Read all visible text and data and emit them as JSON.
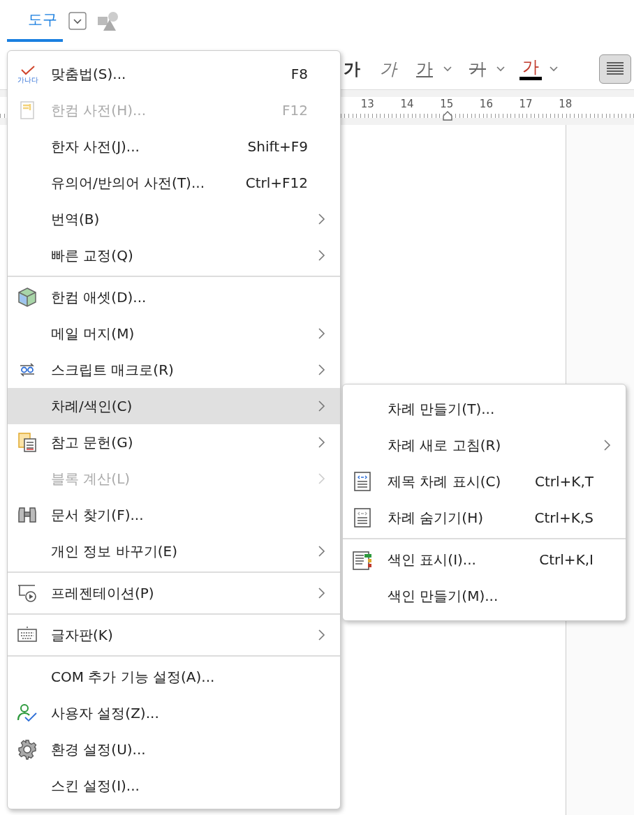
{
  "tabs": [
    {
      "label": "도구",
      "selected": true,
      "dropdown": true
    }
  ],
  "format_buttons": [
    {
      "kind": "bold",
      "label": "가",
      "dropdown": false
    },
    {
      "kind": "italic",
      "label": "가",
      "dropdown": false
    },
    {
      "kind": "underline",
      "label": "가",
      "dropdown": true
    },
    {
      "kind": "strike",
      "label": "가",
      "dropdown": true
    },
    {
      "kind": "color",
      "label": "가",
      "dropdown": true
    }
  ],
  "align_button": {
    "pressed": true
  },
  "ruler": {
    "labels": [
      "13",
      "14",
      "15",
      "16",
      "17",
      "18"
    ]
  },
  "menu": {
    "items": [
      {
        "label": "맞춤법(S)...",
        "shortcut": "F8",
        "icon_label": "가나다",
        "disabled": false,
        "selected": false
      },
      {
        "label": "한컴 사전(H)...",
        "shortcut": "F12",
        "disabled": true,
        "selected": false
      },
      {
        "label": "한자 사전(J)...",
        "shortcut": "Shift+F9",
        "disabled": false,
        "selected": false
      },
      {
        "label": "유의어/반의어 사전(T)...",
        "shortcut": "Ctrl+F12",
        "disabled": false,
        "selected": false
      },
      {
        "label": "번역(B)",
        "submenu": true,
        "disabled": false,
        "selected": false
      },
      {
        "label": "빠른 교정(Q)",
        "submenu": true,
        "disabled": false,
        "selected": false
      },
      {
        "label": "한컴 애셋(D)...",
        "disabled": false,
        "selected": false,
        "separator_before": true
      },
      {
        "label": "메일 머지(M)",
        "submenu": true,
        "disabled": false,
        "selected": false
      },
      {
        "label": "스크립트 매크로(R)",
        "submenu": true,
        "disabled": false,
        "selected": false
      },
      {
        "label": "차례/색인(C)",
        "submenu": true,
        "disabled": false,
        "selected": true
      },
      {
        "label": "참고 문헌(G)",
        "submenu": true,
        "disabled": false,
        "selected": false
      },
      {
        "label": "블록 계산(L)",
        "submenu": true,
        "disabled": true,
        "selected": false
      },
      {
        "label": "문서 찾기(F)...",
        "disabled": false,
        "selected": false
      },
      {
        "label": "개인 정보 바꾸기(E)",
        "submenu": true,
        "disabled": false,
        "selected": false
      },
      {
        "label": "프레젠테이션(P)",
        "submenu": true,
        "disabled": false,
        "selected": false,
        "separator_before": true
      },
      {
        "label": "글자판(K)",
        "submenu": true,
        "disabled": false,
        "selected": false,
        "separator_before": true
      },
      {
        "label": "COM 추가 기능 설정(A)...",
        "disabled": false,
        "selected": false,
        "separator_before": true
      },
      {
        "label": "사용자 설정(Z)...",
        "disabled": false,
        "selected": false
      },
      {
        "label": "환경 설정(U)...",
        "disabled": false,
        "selected": false
      },
      {
        "label": "스킨 설정(I)...",
        "disabled": false,
        "selected": false
      }
    ]
  },
  "submenu": {
    "items": [
      {
        "label": "차례 만들기(T)..."
      },
      {
        "label": "차례 새로 고침(R)",
        "submenu": true
      },
      {
        "label": "제목 차례 표시(C)",
        "shortcut": "Ctrl+K,T"
      },
      {
        "label": "차례 숨기기(H)",
        "shortcut": "Ctrl+K,S"
      },
      {
        "label": "색인 표시(I)...",
        "shortcut": "Ctrl+K,I",
        "separator_before": true
      },
      {
        "label": "색인 만들기(M)..."
      }
    ]
  }
}
